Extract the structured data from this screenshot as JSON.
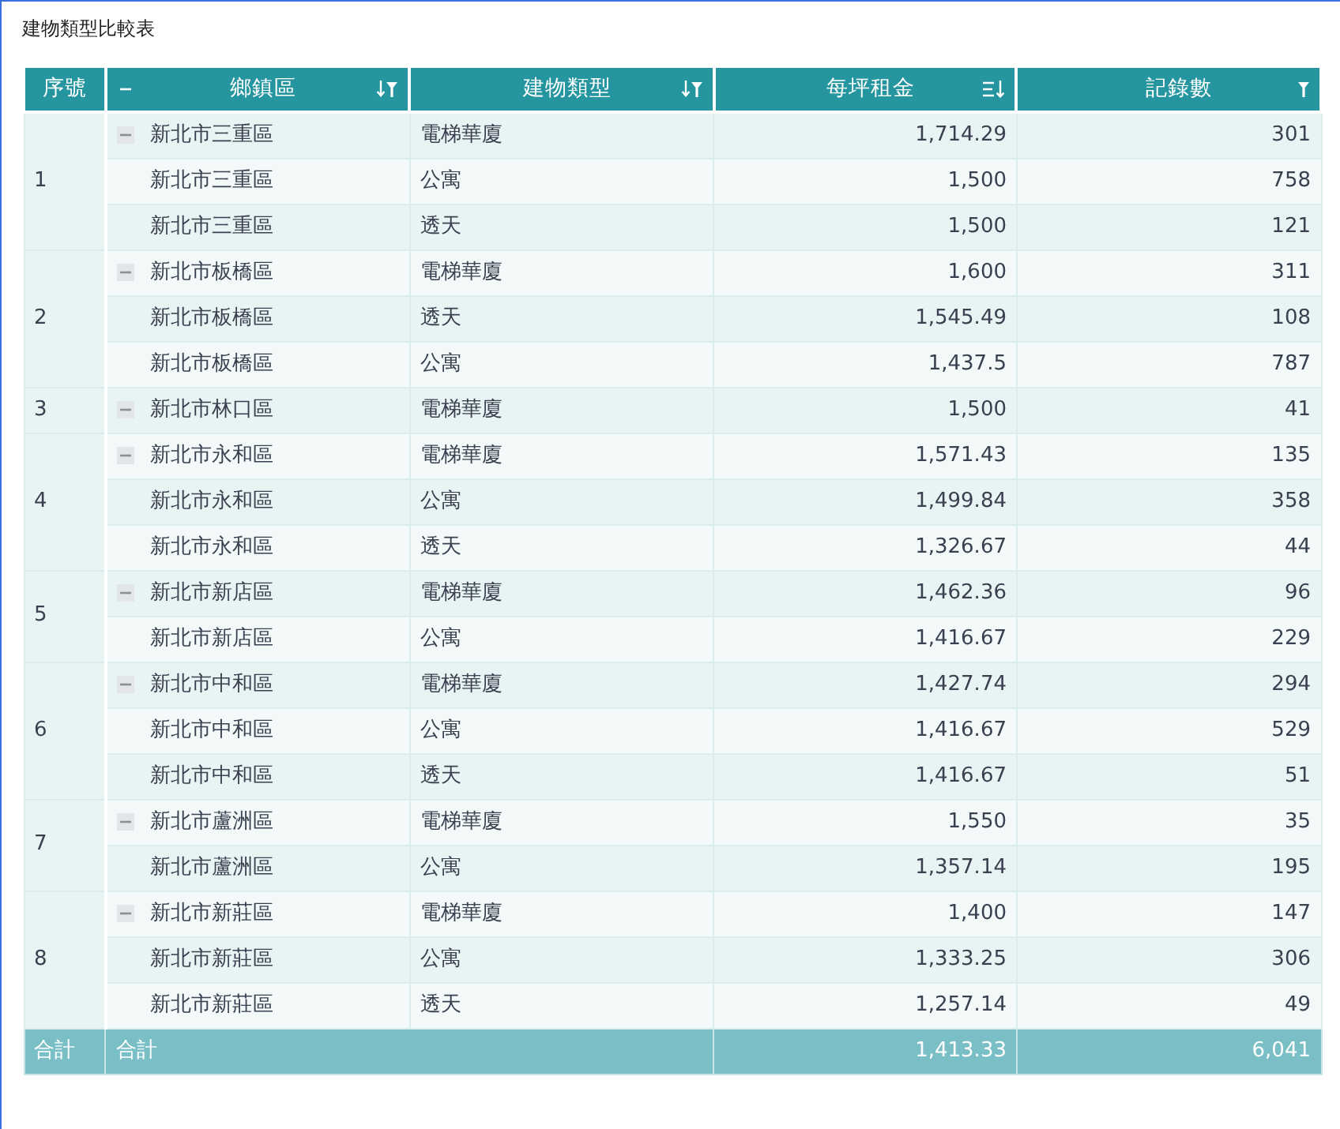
{
  "title": "建物類型比較表",
  "columns": [
    {
      "label": "序號"
    },
    {
      "label": "鄉鎮區",
      "expanded": true
    },
    {
      "label": "建物類型"
    },
    {
      "label": "每坪租金"
    },
    {
      "label": "記錄數"
    }
  ],
  "groups": [
    {
      "index": "1",
      "expanded": true,
      "rows": [
        [
          "新北市三重區",
          "電梯華廈",
          "1,714.29",
          "301"
        ],
        [
          "新北市三重區",
          "公寓",
          "1,500",
          "758"
        ],
        [
          "新北市三重區",
          "透天",
          "1,500",
          "121"
        ]
      ]
    },
    {
      "index": "2",
      "expanded": true,
      "rows": [
        [
          "新北市板橋區",
          "電梯華廈",
          "1,600",
          "311"
        ],
        [
          "新北市板橋區",
          "透天",
          "1,545.49",
          "108"
        ],
        [
          "新北市板橋區",
          "公寓",
          "1,437.5",
          "787"
        ]
      ]
    },
    {
      "index": "3",
      "expanded": true,
      "rows": [
        [
          "新北市林口區",
          "電梯華廈",
          "1,500",
          "41"
        ]
      ]
    },
    {
      "index": "4",
      "expanded": true,
      "rows": [
        [
          "新北市永和區",
          "電梯華廈",
          "1,571.43",
          "135"
        ],
        [
          "新北市永和區",
          "公寓",
          "1,499.84",
          "358"
        ],
        [
          "新北市永和區",
          "透天",
          "1,326.67",
          "44"
        ]
      ]
    },
    {
      "index": "5",
      "expanded": true,
      "rows": [
        [
          "新北市新店區",
          "電梯華廈",
          "1,462.36",
          "96"
        ],
        [
          "新北市新店區",
          "公寓",
          "1,416.67",
          "229"
        ]
      ]
    },
    {
      "index": "6",
      "expanded": true,
      "rows": [
        [
          "新北市中和區",
          "電梯華廈",
          "1,427.74",
          "294"
        ],
        [
          "新北市中和區",
          "公寓",
          "1,416.67",
          "529"
        ],
        [
          "新北市中和區",
          "透天",
          "1,416.67",
          "51"
        ]
      ]
    },
    {
      "index": "7",
      "expanded": true,
      "rows": [
        [
          "新北市蘆洲區",
          "電梯華廈",
          "1,550",
          "35"
        ],
        [
          "新北市蘆洲區",
          "公寓",
          "1,357.14",
          "195"
        ]
      ]
    },
    {
      "index": "8",
      "expanded": true,
      "rows": [
        [
          "新北市新莊區",
          "電梯華廈",
          "1,400",
          "147"
        ],
        [
          "新北市新莊區",
          "公寓",
          "1,333.25",
          "306"
        ],
        [
          "新北市新莊區",
          "透天",
          "1,257.14",
          "49"
        ]
      ]
    }
  ],
  "total": {
    "index_label": "合計",
    "label": "合計",
    "rent": "1,413.33",
    "count": "6,041"
  }
}
